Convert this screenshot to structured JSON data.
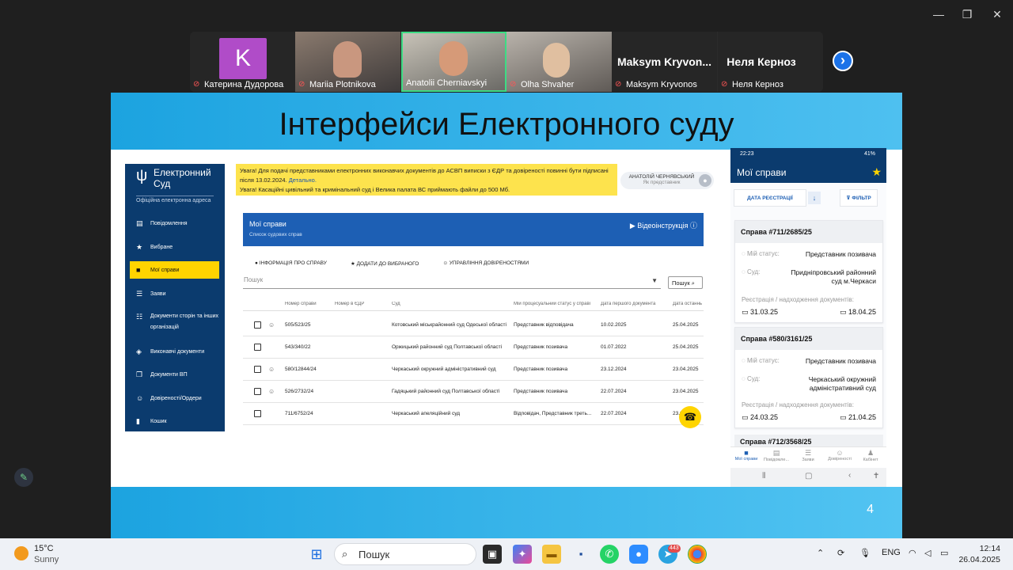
{
  "window": {
    "minimize": "—",
    "restore": "❐",
    "close": "✕"
  },
  "participants": [
    {
      "name": "Катерина Дудорова",
      "avatar_letter": "K"
    },
    {
      "name": "Mariia Plotnikova"
    },
    {
      "name": "Anatolii Cherniavskyi"
    },
    {
      "name": "Olha Shvaher"
    },
    {
      "name": "Maksym Kryvonos",
      "tile_label": "Maksym  Kryvon..."
    },
    {
      "name": "Неля Керноз",
      "tile_label": "Неля Керноз"
    }
  ],
  "strip_next": "›",
  "slide": {
    "title": "Інтерфейси Електронного суду",
    "page_number": "4"
  },
  "app": {
    "logo_title": "Електронний\nСуд",
    "logo_subtitle": "Офіційна електронна адреса",
    "nav": [
      {
        "label": "Повідомлення",
        "icon": "message-icon"
      },
      {
        "label": "Вибране",
        "icon": "star-icon"
      },
      {
        "label": "Мої справи",
        "icon": "folder-icon",
        "active": true
      },
      {
        "label": "Заяви",
        "icon": "list-icon"
      },
      {
        "label": "Документи сторін та інших організацій",
        "icon": "checklist-icon"
      },
      {
        "label": "Виконавчі документи",
        "icon": "layers-icon"
      },
      {
        "label": "Документи ВП",
        "icon": "documents-icon"
      },
      {
        "label": "Довіреності/Ордери",
        "icon": "people-icon"
      },
      {
        "label": "Кошик",
        "icon": "trash-icon"
      }
    ],
    "warning_line1": "Увага! Для подачі представниками електронних виконавчих документів до АСВП виписки з ЄДР та довіреності повинні бути підписані після 13.02.2024.",
    "warning_link": "Детально.",
    "warning_line2": "Увага! Касаційні цивільний та кримінальний суд і Велика палата ВС приймають файли до 500 Мб.",
    "user_name": "АНАТОЛІЙ ЧЕРНЯВСЬКИЙ",
    "user_role": "Як представник",
    "panel_title": "Мої справи",
    "panel_subtitle": "Список судових справ",
    "video_label": "Відеоінструкція",
    "actions": [
      "ІНФОРМАЦІЯ ПРО СПРАВУ",
      "ДОДАТИ ДО ВИБРАНОГО",
      "УПРАВЛІННЯ ДОВІРЕНОСТЯМИ"
    ],
    "search_placeholder": "Пошук",
    "search_button": "Пошук",
    "columns": [
      "Номер справи",
      "Номер в ЄДР",
      "Суд",
      "Мій процесуальний статус у справі",
      "Дата першого документа",
      "Дата останнь"
    ],
    "rows": [
      {
        "case": "505/523/25",
        "edr": "",
        "court": "Котовський міськрайонний суд Одеської області",
        "status": "Представник відповідача",
        "first": "10.02.2025",
        "last": "25.04.2025",
        "person": true
      },
      {
        "case": "543/340/22",
        "edr": "",
        "court": "Оржицький районний суд Полтавської області",
        "status": "Представник позивача",
        "first": "01.07.2022",
        "last": "25.04.2025",
        "person": false
      },
      {
        "case": "580/12844/24",
        "edr": "",
        "court": "Черкаський окружний адміністративний суд",
        "status": "Представник позивача",
        "first": "23.12.2024",
        "last": "23.04.2025",
        "person": true
      },
      {
        "case": "526/2732/24",
        "edr": "",
        "court": "Гадяцький районний суд Полтавської області",
        "status": "Представник позивача",
        "first": "22.07.2024",
        "last": "23.04.2025",
        "person": true
      },
      {
        "case": "711/6752/24",
        "edr": "",
        "court": "Черкаський апеляційний суд",
        "status": "Відповідач, Представник треть...",
        "first": "22.07.2024",
        "last": "23.04.2025",
        "person": false
      }
    ]
  },
  "mobile": {
    "status_time": "22:23",
    "status_right": "41%",
    "title": "Мої справи",
    "sort_label": "ДАТА РЕЄСТРАЦІЇ",
    "filter_label": "ФІЛЬТР",
    "status_label": "Мій статус:",
    "court_label": "Суд:",
    "reg_label": "Реєстрація / надходження документів:",
    "cards": [
      {
        "title": "Справа #711/2685/25",
        "status": "Представник позивача",
        "court": "Придніпровський районний суд м.Черкаси",
        "date1": "31.03.25",
        "date2": "18.04.25"
      },
      {
        "title": "Справа #580/3161/25",
        "status": "Представник позивача",
        "court": "Черкаський окружний адміністративний суд",
        "date1": "24.03.25",
        "date2": "21.04.25"
      }
    ],
    "partial_card": "Справа #712/3568/25",
    "bottom_nav": [
      "Мої справи",
      "Повідомле...",
      "Заяви",
      "Довіреності",
      "Кабінет"
    ]
  },
  "taskbar": {
    "temperature": "15°C",
    "weather": "Sunny",
    "search": "Пошук",
    "language": "ENG",
    "time": "12:14",
    "date": "26.04.2025",
    "telegram_badge": "443"
  },
  "colors": {
    "brand_blue": "#0b3b6e",
    "accent_yellow": "#ffd400",
    "slide_band": "#1ca3e0"
  }
}
